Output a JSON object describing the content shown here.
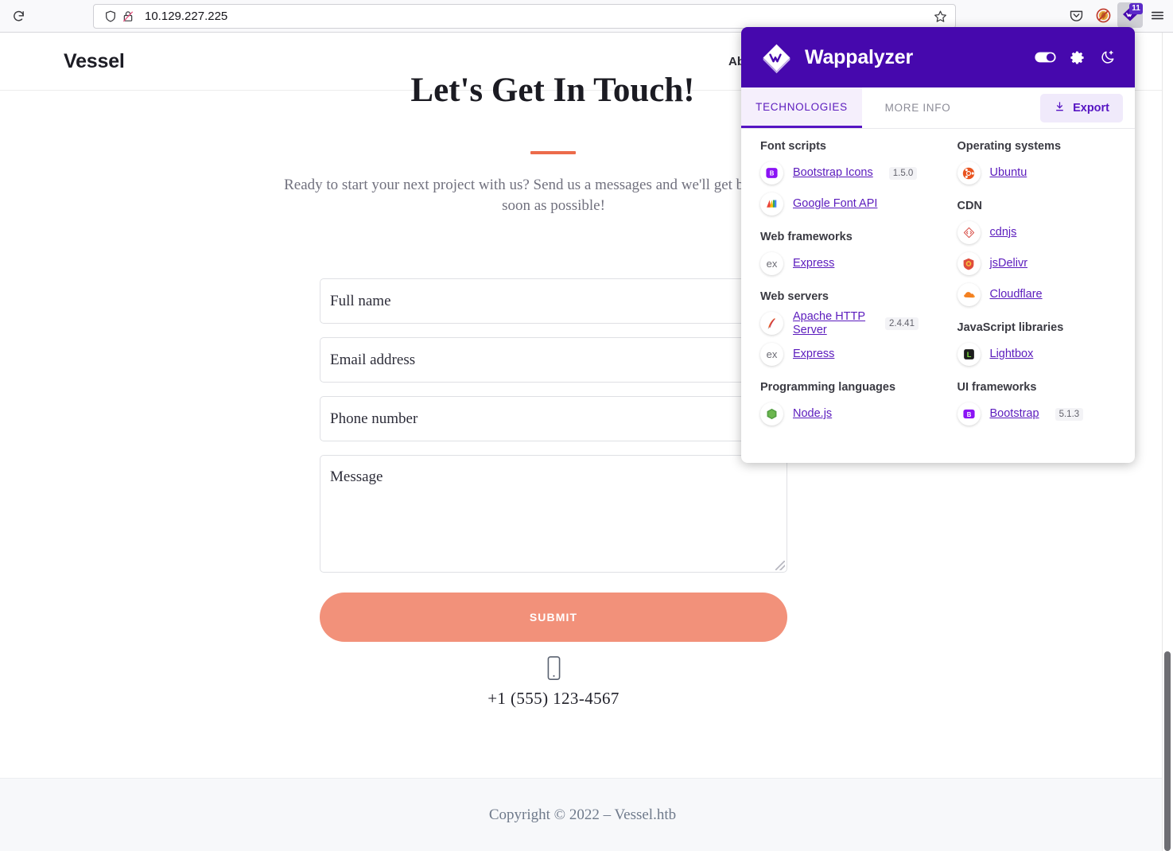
{
  "browser": {
    "reload_icon": "reload-icon",
    "shield_icon": "shield-icon",
    "insecure_lock_icon": "insecure-lock-icon",
    "url": "10.129.227.225",
    "bookmark_icon": "star-icon",
    "pocket_icon": "pocket-icon",
    "blocked_icon": "no-entry-icon",
    "extension_icon": "wappalyzer-extension-icon",
    "extension_badge": "11",
    "menu_icon": "hamburger-menu-icon"
  },
  "site": {
    "brand": "Vessel",
    "nav": [
      {
        "label": "Ab",
        "name": "nav-about"
      }
    ],
    "contact": {
      "heading": "Let's Get In Touch!",
      "subtitle": "Ready to start your next project with us? Send us a messages and we'll get back to you as soon as possible!",
      "fields": [
        {
          "name": "full-name",
          "placeholder": "Full name",
          "value": ""
        },
        {
          "name": "email-address",
          "placeholder": "Email address",
          "value": ""
        },
        {
          "name": "phone-number",
          "placeholder": "Phone number",
          "value": ""
        }
      ],
      "message_placeholder": "Message",
      "message_value": "",
      "submit_label": "SUBMIT",
      "accent_color": "#ec6b4b",
      "submit_color": "#f2917a"
    },
    "phone": {
      "icon": "mobile-phone-icon",
      "number": "+1 (555) 123-4567"
    },
    "footer": {
      "copyright": "Copyright © 2022 – Vessel.htb"
    }
  },
  "wappalyzer": {
    "title": "Wappalyzer",
    "header_color": "#4608ad",
    "accent_color": "#5614c3",
    "logo_icon": "wappalyzer-logo-icon",
    "toggle_icon": "toggle-switch-icon",
    "settings_icon": "gear-icon",
    "theme_icon": "moon-icon",
    "tabs": [
      {
        "label": "TECHNOLOGIES",
        "active": true
      },
      {
        "label": "MORE INFO",
        "active": false
      }
    ],
    "export_label": "Export",
    "export_icon": "download-icon",
    "columns": [
      {
        "categories": [
          {
            "name": "Font scripts",
            "technologies": [
              {
                "name": "Bootstrap Icons",
                "version": "1.5.0",
                "icon": "bootstrap-icons-icon"
              },
              {
                "name": "Google Font API",
                "version": "",
                "icon": "google-font-api-icon"
              }
            ]
          },
          {
            "name": "Web frameworks",
            "technologies": [
              {
                "name": "Express",
                "version": "",
                "icon": "express-icon"
              }
            ]
          },
          {
            "name": "Web servers",
            "technologies": [
              {
                "name": "Apache HTTP Server",
                "version": "2.4.41",
                "icon": "apache-icon"
              },
              {
                "name": "Express",
                "version": "",
                "icon": "express-icon"
              }
            ]
          },
          {
            "name": "Programming languages",
            "technologies": [
              {
                "name": "Node.js",
                "version": "",
                "icon": "nodejs-icon"
              }
            ]
          }
        ]
      },
      {
        "categories": [
          {
            "name": "Operating systems",
            "technologies": [
              {
                "name": "Ubuntu",
                "version": "",
                "icon": "ubuntu-icon"
              }
            ]
          },
          {
            "name": "CDN",
            "technologies": [
              {
                "name": "cdnjs",
                "version": "",
                "icon": "cdnjs-icon"
              },
              {
                "name": "jsDelivr",
                "version": "",
                "icon": "jsdelivr-icon"
              },
              {
                "name": "Cloudflare",
                "version": "",
                "icon": "cloudflare-icon"
              }
            ]
          },
          {
            "name": "JavaScript libraries",
            "technologies": [
              {
                "name": "Lightbox",
                "version": "",
                "icon": "lightbox-icon"
              }
            ]
          },
          {
            "name": "UI frameworks",
            "technologies": [
              {
                "name": "Bootstrap",
                "version": "5.1.3",
                "icon": "bootstrap-icon"
              }
            ]
          }
        ]
      }
    ]
  }
}
